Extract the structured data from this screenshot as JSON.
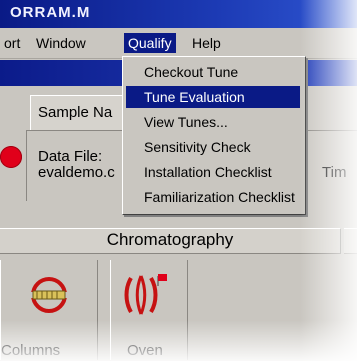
{
  "window": {
    "title": "ORRAM.M"
  },
  "menubar": {
    "items": [
      {
        "label": "ort"
      },
      {
        "label": "Window"
      },
      {
        "label": "Qualify"
      },
      {
        "label": "Help"
      }
    ]
  },
  "dropdown": {
    "selected": "Tune Evaluation",
    "items": [
      {
        "label": "Checkout Tune"
      },
      {
        "label": "Tune Evaluation"
      },
      {
        "label": "View Tunes..."
      },
      {
        "label": "Sensitivity Check"
      },
      {
        "label": "Installation Checklist"
      },
      {
        "label": "Familiarization Checklist"
      }
    ]
  },
  "panel": {
    "sample_label": "Sample Na",
    "datafile_label": "Data File:",
    "datafile_value": "evaldemo.c",
    "time_label": "Tim"
  },
  "section": {
    "title": "Chromatography"
  },
  "toolbar": {
    "buttons": [
      {
        "label": "Columns",
        "icon": "columns-icon"
      },
      {
        "label": "Oven",
        "icon": "oven-icon"
      }
    ]
  },
  "colors": {
    "title_blue": "#0a1a86",
    "status_red": "#e0001a",
    "window_gray": "#c9c6c0"
  }
}
